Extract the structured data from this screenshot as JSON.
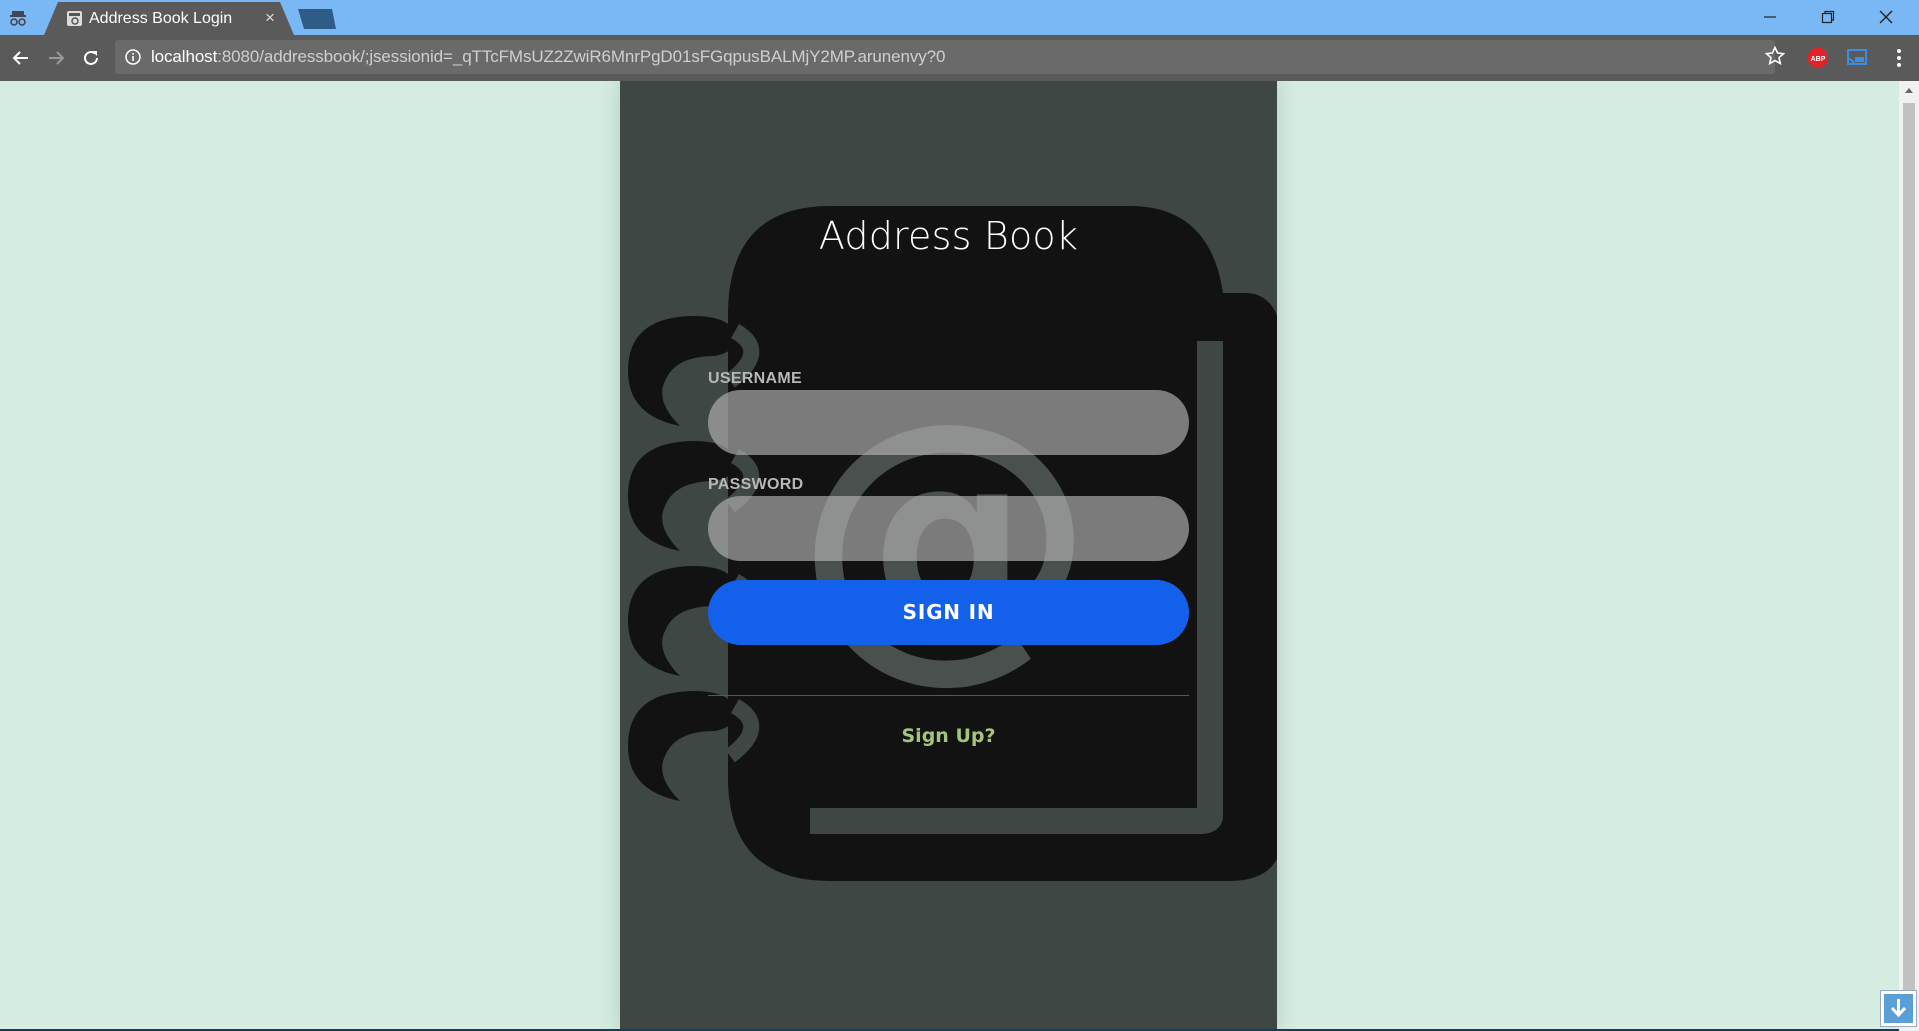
{
  "browser": {
    "tab_title": "Address Book Login",
    "tab_close": "×",
    "url_host": "localhost",
    "url_rest": ":8080/addressbook/;jsessionid=_qTTcFMsUZ2ZwiR6MnrPgD01sFGqpusBALMjY2MP.arunenvy?0",
    "abp_label": "ABP",
    "icons": {
      "incognito": "incognito-icon",
      "favicon": "address-book-favicon",
      "back": "back-arrow-icon",
      "forward": "forward-arrow-icon",
      "reload": "reload-icon",
      "info": "info-icon",
      "bookmark": "star-icon",
      "adblock": "adblock-icon",
      "cast": "cast-icon",
      "menu": "kebab-menu-icon",
      "minimize": "minimize-icon",
      "restore": "restore-icon",
      "close": "close-icon"
    }
  },
  "login": {
    "title": "Address Book",
    "username_label": "USERNAME",
    "username_value": "",
    "password_label": "PASSWORD",
    "password_value": "",
    "signin_label": "SIGN IN",
    "signup_label": "Sign Up?"
  },
  "colors": {
    "page_bg": "#d4ede0",
    "panel_bg": "#3f4744",
    "button_bg": "#1361ea",
    "signup_text": "#a3c47a",
    "titlebar": "#7ab8f5"
  }
}
